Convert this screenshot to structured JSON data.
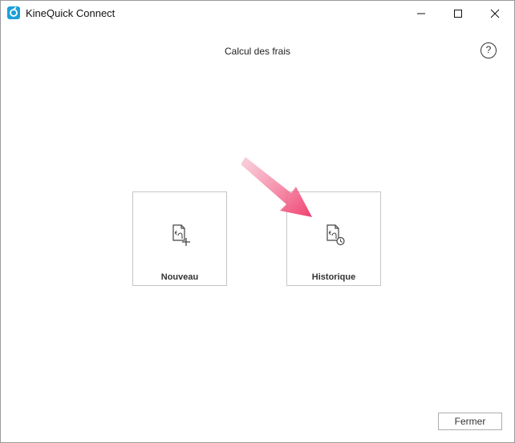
{
  "app": {
    "title": "KineQuick Connect"
  },
  "header": {
    "title": "Calcul des frais",
    "help_label": "?"
  },
  "tiles": [
    {
      "label": "Nouveau",
      "icon": "invoice-add-icon"
    },
    {
      "label": "Historique",
      "icon": "invoice-history-icon"
    }
  ],
  "footer": {
    "close_label": "Fermer"
  },
  "colors": {
    "app_icon": "#1aa0d8",
    "arrow": "#f0406f",
    "tile_border": "#c6c6c6"
  }
}
